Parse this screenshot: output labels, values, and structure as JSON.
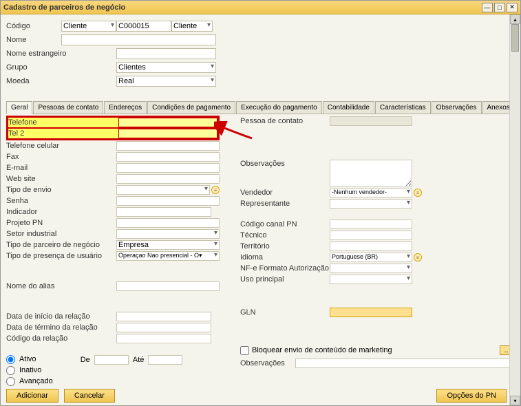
{
  "window": {
    "title": "Cadastro de parceiros de negócio"
  },
  "header": {
    "codigo_label": "Código",
    "codigo_type": "Cliente",
    "codigo_value": "C000015",
    "codigo_role": "Cliente",
    "nome_label": "Nome",
    "nome_estrangeiro_label": "Nome estrangeiro",
    "grupo_label": "Grupo",
    "grupo_value": "Clientes",
    "moeda_label": "Moeda",
    "moeda_value": "Real"
  },
  "tabs": {
    "geral": "Geral",
    "pessoas": "Pessoas de contato",
    "enderecos": "Endereços",
    "condicoes": "Condições de pagamento",
    "execucao": "Execução do pagamento",
    "contabilidade": "Contabilidade",
    "caracteristicas": "Características",
    "observacoes": "Observações",
    "anexos": "Anexos"
  },
  "left": {
    "telefone": "Telefone",
    "tel2": "Tel 2",
    "tel_celular": "Telefone celular",
    "fax": "Fax",
    "email": "E-mail",
    "website": "Web site",
    "tipo_envio": "Tipo de envio",
    "senha": "Senha",
    "indicador": "Indicador",
    "projeto_pn": "Projeto PN",
    "setor_industrial": "Setor industrial",
    "tipo_parceiro": "Tipo de parceiro de negócio",
    "tipo_parceiro_value": "Empresa",
    "tipo_presenca": "Tipo de presença de usuário",
    "tipo_presenca_value": "Operaçao Nao presencial - O▾",
    "nome_alias": "Nome do alias",
    "data_inicio": "Data de início da relação",
    "data_termino": "Data de término da relação",
    "codigo_relacao": "Código da relação",
    "ativo": "Ativo",
    "inativo": "Inativo",
    "avancado": "Avançado",
    "de": "De",
    "ate": "Até"
  },
  "right": {
    "pessoa_contato": "Pessoa de contato",
    "observacoes": "Observações",
    "vendedor": "Vendedor",
    "vendedor_value": "-Nenhum vendedor-",
    "representante": "Representante",
    "codigo_canal": "Código canal PN",
    "tecnico": "Técnico",
    "territorio": "Território",
    "idioma": "Idioma",
    "idioma_value": "Portuguese (BR)",
    "nfe_formato": "NF-e Formato Autorização",
    "uso_principal": "Uso principal",
    "gln": "GLN",
    "bloquear": "Bloquear envio de conteúdo de marketing",
    "observacoes2": "Observações"
  },
  "buttons": {
    "adicionar": "Adicionar",
    "cancelar": "Cancelar",
    "opcoes": "Opções do PN"
  }
}
